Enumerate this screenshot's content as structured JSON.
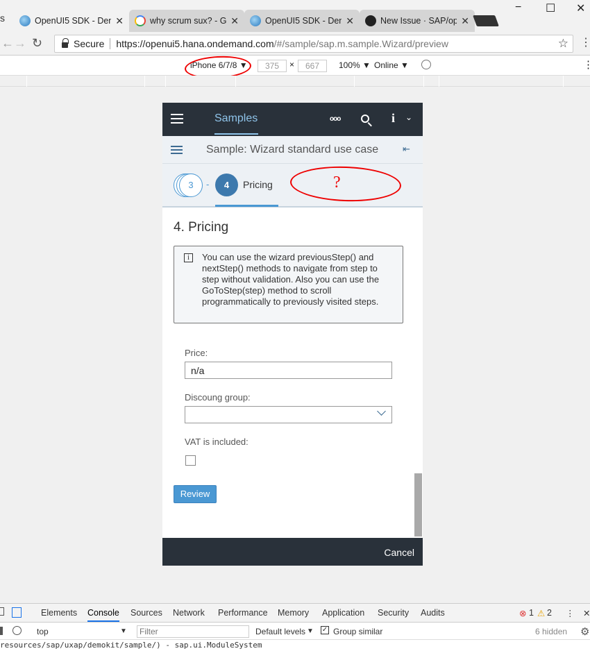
{
  "browser": {
    "tabs": [
      {
        "title": "OpenUI5 SDK - Den",
        "icon": "openui5-icon",
        "active": true
      },
      {
        "title": "why scrum sux? - G",
        "icon": "google-icon",
        "active": false
      },
      {
        "title": "OpenUI5 SDK - Den",
        "icon": "openui5-icon",
        "active": false
      },
      {
        "title": "New Issue · SAP/op",
        "icon": "github-icon",
        "active": false
      }
    ],
    "close_glyph": "✕",
    "window_controls": {
      "minimize": "−",
      "maximize": "☐",
      "close": "✕"
    },
    "secure_label": "Secure",
    "url_main": "https://openui5.hana.ondemand.com",
    "url_rest": "/#/sample/sap.m.sample.Wizard/preview",
    "star": "☆"
  },
  "device_toolbar": {
    "device": "iPhone 6/7/8",
    "width": "375",
    "times": "×",
    "height": "667",
    "zoom": "100%",
    "network": "Online",
    "caret": "▼"
  },
  "app": {
    "shell_title": "Samples",
    "more": "ooo",
    "info": "i",
    "page_title": "Sample: Wizard standard use case",
    "wizard": {
      "prev_step": "3",
      "separator": "-",
      "current_step": "4",
      "current_label": "Pricing"
    },
    "annotation": "?",
    "section_title": "4. Pricing",
    "info_text": "You can use the wizard previousStep() and nextStep() methods to navigate from step to step without validation. Also you can use the GoToStep(step) method to scroll programmatically to previously visited steps.",
    "price_label": "Price:",
    "price_value": "n/a",
    "discount_label": "Discoung group:",
    "discount_value": "",
    "vat_label": "VAT is included:",
    "vat_checked": false,
    "review_button": "Review",
    "cancel_button": "Cancel"
  },
  "devtools": {
    "tabs": [
      "Elements",
      "Console",
      "Sources",
      "Network",
      "Performance",
      "Memory",
      "Application",
      "Security",
      "Audits"
    ],
    "active_tab": "Console",
    "errors": "1",
    "warnings": "2",
    "context": "top",
    "filter_placeholder": "Filter",
    "levels": "Default levels",
    "group_similar": "Group similar",
    "hidden": "6 hidden",
    "log_line": "resources/sap/uxap/demokit/sample/) - sap.ui.ModuleSystem"
  },
  "colors": {
    "shell": "#29313a",
    "accent": "#4a98d3",
    "annotation": "#e00000"
  }
}
